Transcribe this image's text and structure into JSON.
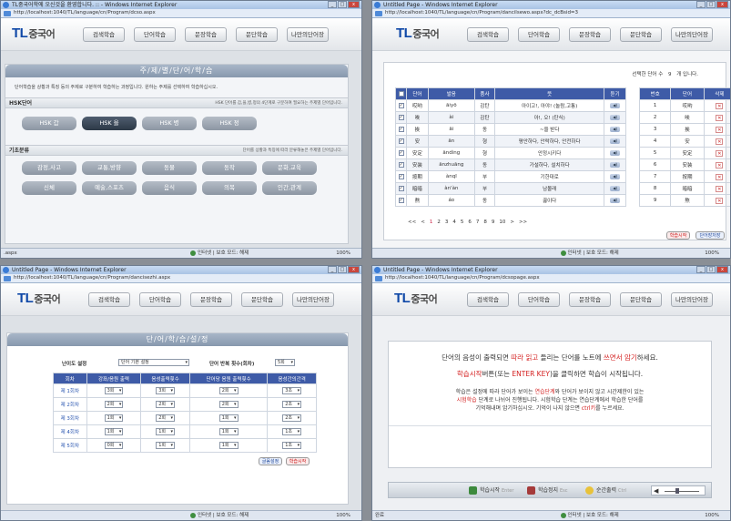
{
  "common": {
    "logo_main": "TL",
    "logo_sub": "중국어",
    "nav": [
      "검색학습",
      "단어학습",
      "문장학습",
      "문단학습",
      "나만의단어장"
    ],
    "zone": "인터넷 | 보호 모드: 해제",
    "zoom": "100%",
    "win_controls": [
      "_",
      "□",
      "x"
    ]
  },
  "w1": {
    "title": "TL중국어학에 오신것을 환영합니다. :: - Windows Internet Explorer",
    "address": "http://localhost:1040/TL/language/cn/Program/dcso.aspx",
    "page_title": "주/제/별/단/어/학/습",
    "intro": "단어학습을 상황과 특징 등의 주제로 구분하여 학습하는 과정입니다. 원하는 주제를 선택하여 학습하십시오.",
    "hsk_label": "HSK단어",
    "hsk_desc": "HSK 단어를 갑,을,병,정의 4단계로 구분하여 필요하는 주제별 단어입니다.",
    "hsk_buttons": [
      "HSK 갑",
      "HSK 을",
      "HSK 병",
      "HSK 정"
    ],
    "basic_label": "기초분류",
    "basic_desc": "단어를 상황과 특징에 따라 분류해놓은 주제별 단어입니다.",
    "basic_buttons": [
      "감정,사고",
      "교통,방향",
      "동물",
      "동작",
      "문화,교육",
      "신체",
      "예술,스포츠",
      "음식",
      "의복",
      "인간,관계"
    ],
    "status": ".aspx"
  },
  "w2": {
    "title": "Untitled Page - Windows Internet Explorer",
    "address": "http://localhost:1040/TL/language/cn/Program/dancilsewo.aspx?dc_dcBsid=3",
    "selected_text": "선택한 단어 수",
    "selected_count": "9",
    "selected_unit": "개 입니다.",
    "headers": [
      "단어",
      "발음",
      "품사",
      "뜻",
      "듣기"
    ],
    "rows": [
      {
        "word": "哎哟",
        "pron": "āiyō",
        "pos": "감탄",
        "mean": "아이고!, 아야! (놀람,고통)"
      },
      {
        "word": "唉",
        "pron": "ài",
        "pos": "감탄",
        "mean": "아!, 오! (탄식)"
      },
      {
        "word": "挨",
        "pron": "āi",
        "pos": "동",
        "mean": "~을 받다"
      },
      {
        "word": "安",
        "pron": "ān",
        "pos": "형",
        "mean": "평안하다, 안락하다, 안전하다"
      },
      {
        "word": "安定",
        "pron": "āndìng",
        "pos": "형",
        "mean": "안정시키다"
      },
      {
        "word": "安装",
        "pron": "ānzhuāng",
        "pos": "동",
        "mean": "가설하다, 설치하다"
      },
      {
        "word": "按期",
        "pron": "ànqī",
        "pos": "부",
        "mean": "기한대로"
      },
      {
        "word": "暗暗",
        "pron": "àn'àn",
        "pos": "부",
        "mean": "남몰래"
      },
      {
        "word": "熬",
        "pron": "áo",
        "pos": "동",
        "mean": "끓이다"
      }
    ],
    "pager": [
      "<<",
      "<",
      "1",
      "2",
      "3",
      "4",
      "5",
      "6",
      "7",
      "8",
      "9",
      "10",
      ">",
      ">>"
    ],
    "side_headers": [
      "번호",
      "단어",
      "삭제"
    ],
    "side_rows": [
      {
        "n": "1",
        "w": "哎哟"
      },
      {
        "n": "2",
        "w": "唉"
      },
      {
        "n": "3",
        "w": "挨"
      },
      {
        "n": "4",
        "w": "安"
      },
      {
        "n": "5",
        "w": "安定"
      },
      {
        "n": "6",
        "w": "安装"
      },
      {
        "n": "7",
        "w": "按期"
      },
      {
        "n": "8",
        "w": "暗暗"
      },
      {
        "n": "9",
        "w": "熬"
      }
    ],
    "btn_study": "학습시작",
    "btn_save": "단어장저장"
  },
  "w3": {
    "title": "Untitled Page - Windows Internet Explorer",
    "address": "http://localhost:1040/TL/language/cn/Program/dancisezhi.aspx",
    "page_title": "단/어/학/습/설/정",
    "difficulty_label": "난이도 설정",
    "difficulty_value": "단어 기본 설정",
    "repeat_label": "단어 반복 횟수(회차)",
    "repeat_value": "5회",
    "headers": [
      "회차",
      "강좌/음원 출력",
      "음성출력횟수",
      "단어당 음원 출력횟수",
      "음성간의간격"
    ],
    "rows": [
      {
        "label": "제 1회차",
        "a": "3회",
        "b": "3회",
        "c": "2회",
        "d": "3초"
      },
      {
        "label": "제 2회차",
        "a": "2회",
        "b": "2회",
        "c": "2회",
        "d": "2초"
      },
      {
        "label": "제 3회차",
        "a": "1회",
        "b": "2회",
        "c": "1회",
        "d": "2초"
      },
      {
        "label": "제 4회차",
        "a": "1회",
        "b": "1회",
        "c": "1회",
        "d": "1초"
      },
      {
        "label": "제 5회차",
        "a": "0회",
        "b": "1회",
        "c": "1회",
        "d": "1초"
      }
    ],
    "btn_default": "글몸설정",
    "btn_start": "학습시작"
  },
  "w4": {
    "title": "Untitled Page - Windows Internet Explorer",
    "address": "http://localhost:1040/TL/language/cn/Program/dcsopage.aspx",
    "line1_a": "단어의 음성이 출력되면 ",
    "line1_b": "따라 읽고",
    "line1_c": " 들리는 단어를 노트에 ",
    "line1_d": "쓰면서 암기",
    "line1_e": "하세요.",
    "line2_a": "학습시작",
    "line2_b": "버튼(또는 ",
    "line2_c": "ENTER KEY",
    "line2_d": ")을 클릭하면 학습이 시작됩니다.",
    "para1_a": "학습은 설정에 따라 단어가 보이는 ",
    "para1_b": "연습단계",
    "para1_c": "와 단어가 보이지 않고 시간제한이 있는",
    "para2_a": "시험학습",
    "para2_b": " 단계로 나뉘어 진행됩니다. 시험학습 단계는 연습단계에서 학습한 단어를",
    "para3_a": "기억해내며 암기하십시오. 기억이 나지 않으면 ",
    "para3_b": "ctrl키",
    "para3_c": "를 누르세요.",
    "ctrl_start": "학습시작",
    "ctrl_start_key": "Enter",
    "ctrl_stop": "학습정지",
    "ctrl_stop_key": "Esc",
    "ctrl_hint": "순간출력",
    "ctrl_hint_key": "Ctrl",
    "status": "완료"
  }
}
